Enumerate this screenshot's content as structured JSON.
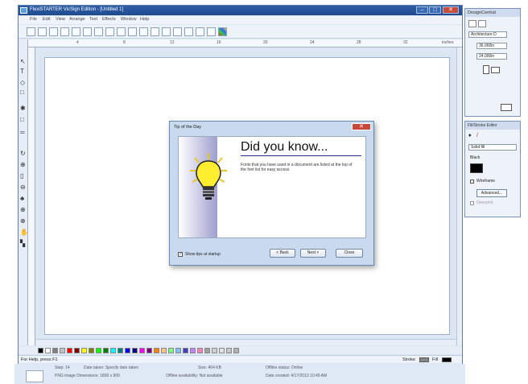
{
  "window": {
    "title": "FlexiSTARTER VicSign Edition - [Untitled 1]",
    "controls": {
      "minimize": "–",
      "maximize": "□",
      "close": "✕"
    }
  },
  "menu": [
    "File",
    "Edit",
    "View",
    "Arrange",
    "Text",
    "Effects",
    "Window",
    "Help"
  ],
  "ruler": {
    "unit": "inches",
    "ticks": [
      "4",
      "8",
      "12",
      "16",
      "20",
      "24",
      "28",
      "32"
    ]
  },
  "status": {
    "help": "For Help, press F1",
    "stroke": "Stroke",
    "fill": "Fill"
  },
  "dialog": {
    "title": "Tip of the Day",
    "close": "✕",
    "heading": "Did you know...",
    "tip": "Fonts that you have used in a document are listed at the top of the font list for easy access.",
    "show_tips": "Show tips at startup",
    "back": "< Back",
    "next": "Next >",
    "close_button": "Close"
  },
  "design_central": {
    "header": "DesignCentral",
    "preset": "Architecture D",
    "width": "36.000in",
    "height": "24.000in"
  },
  "fill_stroke": {
    "header": "Fill/Stroke Editor",
    "mode": "Solid fill",
    "color_name": "Black",
    "wireframe": "Wireframe",
    "advanced": "Advanced...",
    "overprint": "Overprint"
  },
  "info": {
    "step": "Step: 14",
    "date_taken": "Date taken: Specify date taken",
    "size": "Size: 404 KB",
    "offline_status": "Offline status: Online",
    "image_type": "PNG image  Dimensions: 1800 x 900",
    "offline_avail": "Offline availability: Not available",
    "date_created": "Date created: 4/17/2013 10:49 AM"
  },
  "palette_colors": [
    "#000000",
    "#ffffff",
    "#808080",
    "#c0c0c0",
    "#ff0000",
    "#800000",
    "#ffff00",
    "#808000",
    "#00ff00",
    "#008000",
    "#00ffff",
    "#008080",
    "#0000ff",
    "#000080",
    "#ff00ff",
    "#800080",
    "#ff8000",
    "#ffc080",
    "#80ff80",
    "#80c0ff",
    "#4040c0",
    "#c080ff",
    "#ff80c0",
    "#a0a0a0",
    "#d0d0d0",
    "#e0e0e0",
    "#c8c8c8",
    "#b0b0b0"
  ]
}
